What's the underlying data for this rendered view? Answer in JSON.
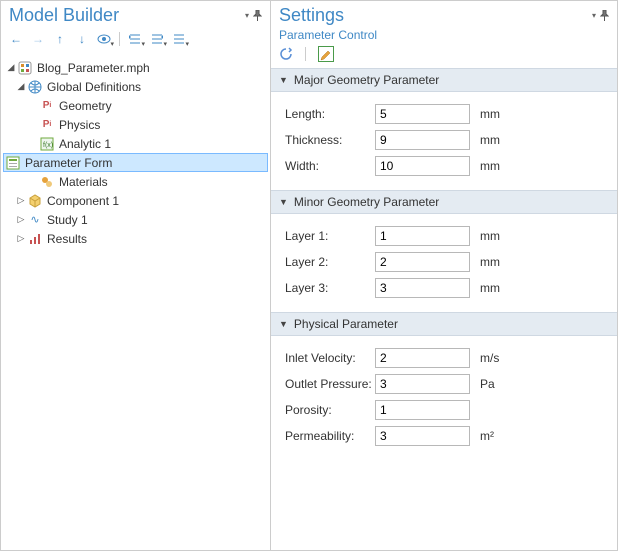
{
  "modelBuilder": {
    "title": "Model Builder",
    "tree": {
      "root": "Blog_Parameter.mph",
      "globalDefs": "Global Definitions",
      "geometry": "Geometry",
      "physics": "Physics",
      "analytic": "Analytic 1",
      "paramForm": "Parameter Form",
      "materials": "Materials",
      "component": "Component 1",
      "study": "Study 1",
      "results": "Results"
    }
  },
  "settings": {
    "title": "Settings",
    "subtitle": "Parameter Control",
    "sections": {
      "major": {
        "title": "Major Geometry Parameter",
        "rows": [
          {
            "label": "Length:",
            "value": "5",
            "unit": "mm"
          },
          {
            "label": "Thickness:",
            "value": "9",
            "unit": "mm"
          },
          {
            "label": "Width:",
            "value": "10",
            "unit": "mm"
          }
        ]
      },
      "minor": {
        "title": "Minor Geometry Parameter",
        "rows": [
          {
            "label": "Layer 1:",
            "value": "1",
            "unit": "mm"
          },
          {
            "label": "Layer 2:",
            "value": "2",
            "unit": "mm"
          },
          {
            "label": "Layer 3:",
            "value": "3",
            "unit": "mm"
          }
        ]
      },
      "physical": {
        "title": "Physical Parameter",
        "rows": [
          {
            "label": "Inlet Velocity:",
            "value": "2",
            "unit": "m/s"
          },
          {
            "label": "Outlet Pressure:",
            "value": "3",
            "unit": "Pa"
          },
          {
            "label": "Porosity:",
            "value": "1",
            "unit": ""
          },
          {
            "label": "Permeability:",
            "value": "3",
            "unit": "m²"
          }
        ]
      }
    }
  }
}
